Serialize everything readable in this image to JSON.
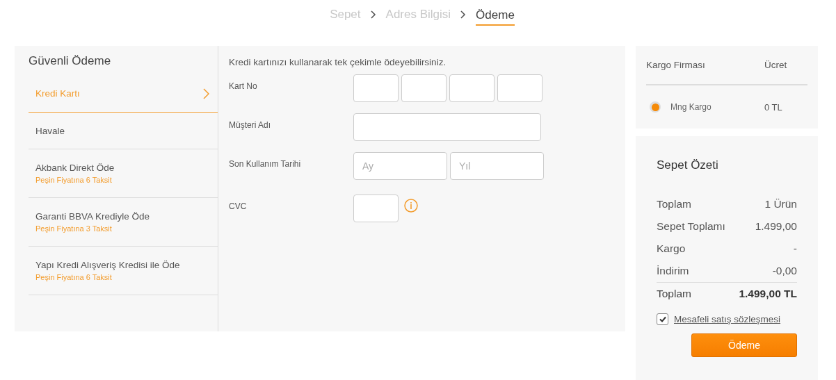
{
  "breadcrumb": [
    {
      "label": "Sepet",
      "selected": false
    },
    {
      "label": "Adres Bilgisi",
      "selected": false
    },
    {
      "label": "Ödeme",
      "selected": true
    }
  ],
  "payment": {
    "title": "Güvenli Ödeme",
    "methods": [
      {
        "label": "Kredi Kartı",
        "selected": true
      },
      {
        "label": "Havale",
        "selected": false
      },
      {
        "label": "Akbank Direkt Öde",
        "note": "Peşin Fiyatına 6 Taksit",
        "selected": false
      },
      {
        "label": "Garanti BBVA Krediyle Öde",
        "note": "Peşin Fiyatına 3 Taksit",
        "selected": false
      },
      {
        "label": "Yapı Kredi Alışveriş Kredisi ile Öde",
        "note": "Peşin Fiyatına 6 Taksit",
        "selected": false
      }
    ]
  },
  "card_form": {
    "intro": "Kredi kartınızı kullanarak tek çekimle ödeyebilirsiniz.",
    "fields": [
      {
        "label": "Kart No",
        "kind": "card"
      },
      {
        "label": "Müşteri Adı",
        "kind": "text"
      },
      {
        "label": "Son Kullanım Tarihi",
        "kind": "date",
        "placeholders": [
          "Ay",
          "Yıl"
        ]
      },
      {
        "label": "CVC",
        "kind": "cvc"
      }
    ]
  },
  "shipping": {
    "columns": [
      "Kargo Firması",
      "Ücret"
    ],
    "options": [
      {
        "name": "Mng Kargo",
        "price": "0 TL",
        "selected": true
      }
    ]
  },
  "summary": {
    "title": "Sepet Özeti",
    "rows": [
      {
        "label": "Toplam",
        "value": "1 Ürün",
        "kind": "line"
      },
      {
        "label": "Sepet Toplamı",
        "value": "1.499,00",
        "kind": "line"
      },
      {
        "label": "Kargo",
        "value": "-",
        "kind": "line"
      },
      {
        "label": "İndirim",
        "value": "-0,00",
        "kind": "line"
      },
      {
        "label": "Toplam",
        "value": "1.499,00 TL",
        "kind": "total"
      }
    ],
    "agreement": {
      "label": "Mesafeli satış sözleşmesi",
      "checked": true
    },
    "button": "Ödeme"
  }
}
